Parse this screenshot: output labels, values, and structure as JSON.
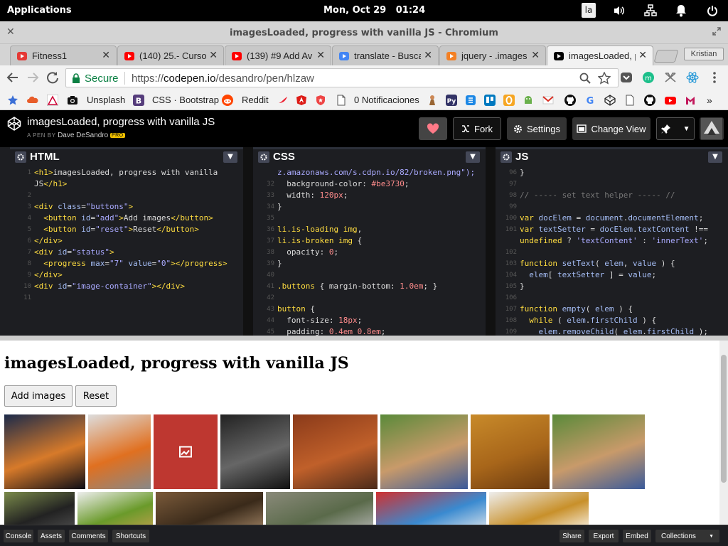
{
  "system_bar": {
    "applications_label": "Applications",
    "clock": "Mon, Oct 29   01:24",
    "keyboard_layout": "la"
  },
  "window": {
    "title": "imagesLoaded, progress with vanilla JS - Chromium"
  },
  "tabs": [
    {
      "label": "Fitness1",
      "icon": "fitness-favicon",
      "color": "#e53935"
    },
    {
      "label": "(140) 25.- Curso",
      "icon": "youtube-favicon",
      "color": "#ff0000"
    },
    {
      "label": "(139) #9 Add Av",
      "icon": "youtube-favicon",
      "color": "#ff0000"
    },
    {
      "label": "translate - Busca",
      "icon": "google-favicon",
      "color": "#4285f4"
    },
    {
      "label": "jquery - .images",
      "icon": "stackoverflow-favicon",
      "color": "#f48024"
    },
    {
      "label": "imagesLoaded, p",
      "icon": "codepen-favicon",
      "color": "#000000",
      "active": true
    }
  ],
  "profile_name": "Kristian",
  "omnibox": {
    "secure_label": "Secure",
    "url_prefix": "https://",
    "url_domain": "codepen.io",
    "url_path": "/desandro/pen/hlzaw"
  },
  "bookmarks": [
    {
      "label": "Unsplash"
    },
    {
      "label": "CSS · Bootstrap"
    },
    {
      "label": "Reddit"
    },
    {
      "label": "0 Notificaciones"
    }
  ],
  "codepen": {
    "pen_title": "imagesLoaded, progress with vanilla JS",
    "by_prefix": "A PEN BY",
    "author": "Dave DeSandro",
    "pro_badge": "PRO",
    "buttons": {
      "fork": "Fork",
      "settings": "Settings",
      "change_view": "Change View"
    },
    "heart_color": "#ff3c41"
  },
  "editors": {
    "html": {
      "title": "HTML",
      "lines": [
        {
          "n": "1",
          "html": "<span class=\"t-tag\">&lt;h1&gt;</span>imagesLoaded, progress with vanilla"
        },
        {
          "n": "",
          "html": "JS<span class=\"t-tag\">&lt;/h1&gt;</span>"
        },
        {
          "n": "2",
          "html": ""
        },
        {
          "n": "3",
          "html": "<span class=\"t-tag\">&lt;div</span> <span class=\"t-attr\">class</span>=<span class=\"t-str\">\"buttons\"</span><span class=\"t-tag\">&gt;</span>"
        },
        {
          "n": "4",
          "html": "  <span class=\"t-tag\">&lt;button</span> <span class=\"t-attr\">id</span>=<span class=\"t-str\">\"add\"</span><span class=\"t-tag\">&gt;</span>Add images<span class=\"t-tag\">&lt;/button&gt;</span>"
        },
        {
          "n": "5",
          "html": "  <span class=\"t-tag\">&lt;button</span> <span class=\"t-attr\">id</span>=<span class=\"t-str\">\"reset\"</span><span class=\"t-tag\">&gt;</span>Reset<span class=\"t-tag\">&lt;/button&gt;</span>"
        },
        {
          "n": "6",
          "html": "<span class=\"t-tag\">&lt;/div&gt;</span>"
        },
        {
          "n": "7",
          "html": "<span class=\"t-tag\">&lt;div</span> <span class=\"t-attr\">id</span>=<span class=\"t-str\">\"status\"</span><span class=\"t-tag\">&gt;</span>"
        },
        {
          "n": "8",
          "html": "  <span class=\"t-tag\">&lt;progress</span> <span class=\"t-attr\">max</span>=<span class=\"t-str\">\"7\"</span> <span class=\"t-attr\">value</span>=<span class=\"t-str\">\"0\"</span><span class=\"t-tag\">&gt;&lt;/progress&gt;</span>"
        },
        {
          "n": "9",
          "html": "<span class=\"t-tag\">&lt;/div&gt;</span>"
        },
        {
          "n": "10",
          "html": "<span class=\"t-tag\">&lt;div</span> <span class=\"t-attr\">id</span>=<span class=\"t-str\">\"image-container\"</span><span class=\"t-tag\">&gt;&lt;/div&gt;</span>"
        },
        {
          "n": "11",
          "html": ""
        }
      ]
    },
    "css": {
      "title": "CSS",
      "lines": [
        {
          "n": "",
          "html": "<span class=\"t-str\">z.amazonaws.com/s.cdpn.io/82/broken.png\");</span>"
        },
        {
          "n": "32",
          "html": "  <span class=\"t-prop\">background-color</span>: <span class=\"t-num\">#be3730</span>;"
        },
        {
          "n": "33",
          "html": "  <span class=\"t-prop\">width</span>: <span class=\"t-num\">120px</span>;"
        },
        {
          "n": "34",
          "html": "}"
        },
        {
          "n": "35",
          "html": ""
        },
        {
          "n": "36",
          "html": "<span class=\"t-sel\">li.is-loading img</span>,"
        },
        {
          "n": "37",
          "html": "<span class=\"t-sel\">li.is-broken img</span> {"
        },
        {
          "n": "38",
          "html": "  <span class=\"t-prop\">opacity</span>: <span class=\"t-num\">0</span>;"
        },
        {
          "n": "39",
          "html": "}"
        },
        {
          "n": "40",
          "html": ""
        },
        {
          "n": "41",
          "html": "<span class=\"t-sel\">.buttons</span> { <span class=\"t-prop\">margin-bottom</span>: <span class=\"t-num\">1.0em</span>; }"
        },
        {
          "n": "42",
          "html": ""
        },
        {
          "n": "43",
          "html": "<span class=\"t-sel\">button</span> {"
        },
        {
          "n": "44",
          "html": "  <span class=\"t-prop\">font-size</span>: <span class=\"t-num\">18px</span>;"
        },
        {
          "n": "45",
          "html": "  <span class=\"t-prop\">padding</span>: <span class=\"t-num\">0.4em 0.8em</span>;"
        }
      ]
    },
    "js": {
      "title": "JS",
      "lines": [
        {
          "n": "96",
          "html": "}"
        },
        {
          "n": "97",
          "html": ""
        },
        {
          "n": "98",
          "html": "<span class=\"t-com\">// ----- set text helper ----- //</span>"
        },
        {
          "n": "99",
          "html": ""
        },
        {
          "n": "100",
          "html": "<span class=\"t-kw\">var</span> <span class=\"t-var\">docElem</span> = <span class=\"t-var\">document</span>.<span class=\"t-var\">documentElement</span>;"
        },
        {
          "n": "101",
          "html": "<span class=\"t-kw\">var</span> <span class=\"t-var\">textSetter</span> = <span class=\"t-var\">docElem</span>.<span class=\"t-var\">textContent</span> !=="
        },
        {
          "n": "",
          "html": "<span class=\"t-kw\">undefined</span> ? <span class=\"t-str\">'textContent'</span> : <span class=\"t-str\">'innerText'</span>;"
        },
        {
          "n": "102",
          "html": ""
        },
        {
          "n": "103",
          "html": "<span class=\"t-kw\">function</span> <span class=\"t-var\">setText</span>( <span class=\"t-var\">elem</span>, <span class=\"t-var\">value</span> ) {"
        },
        {
          "n": "104",
          "html": "  <span class=\"t-var\">elem</span>[ <span class=\"t-var\">textSetter</span> ] = <span class=\"t-var\">value</span>;"
        },
        {
          "n": "105",
          "html": "}"
        },
        {
          "n": "106",
          "html": ""
        },
        {
          "n": "107",
          "html": "<span class=\"t-kw\">function</span> <span class=\"t-var\">empty</span>( <span class=\"t-var\">elem</span> ) {"
        },
        {
          "n": "108",
          "html": "  <span class=\"t-kw\">while</span> ( <span class=\"t-var\">elem</span>.<span class=\"t-var\">firstChild</span> ) {"
        },
        {
          "n": "109",
          "html": "    <span class=\"t-var\">elem</span>.<span class=\"t-var\">removeChild</span>( <span class=\"t-var\">elem</span>.<span class=\"t-var\">firstChild</span> );"
        }
      ]
    }
  },
  "preview": {
    "heading": "imagesLoaded, progress with vanilla JS",
    "add_button": "Add images",
    "reset_button": "Reset",
    "images_row1": [
      {
        "name": "city-skyline-image",
        "colors": [
          "#1b2a4a",
          "#d77a2a",
          "#0d0d16"
        ]
      },
      {
        "name": "orange-ipod-image",
        "colors": [
          "#ddd",
          "#e07020",
          "#888"
        ]
      },
      {
        "name": "broken-image",
        "colors": [
          "#be3730",
          "#be3730",
          "#be3730"
        ]
      },
      {
        "name": "electronics-knobs-image",
        "colors": [
          "#222",
          "#666",
          "#111"
        ]
      },
      {
        "name": "autumn-trees-image",
        "colors": [
          "#8a3a1a",
          "#c0602a",
          "#4a2a1a"
        ]
      },
      {
        "name": "baseball-players-image",
        "colors": [
          "#5a8a3a",
          "#c89a6a",
          "#3a5a9a"
        ]
      },
      {
        "name": "potatoes-image",
        "colors": [
          "#c88a2a",
          "#a8661a",
          "#6a3a10"
        ]
      },
      {
        "name": "baseball-catcher-image",
        "colors": [
          "#5a8a3a",
          "#c89a6a",
          "#3a5a9a"
        ]
      }
    ],
    "images_row2": [
      {
        "name": "dark-fabric-image",
        "colors": [
          "#7a8a4a",
          "#222",
          "#555"
        ]
      },
      {
        "name": "food-plate-image",
        "colors": [
          "#eee",
          "#6a9a2a",
          "#c8a050"
        ]
      },
      {
        "name": "old-man-portrait-image",
        "colors": [
          "#7a5a3a",
          "#3a2a1a",
          "#a88a6a"
        ]
      },
      {
        "name": "stone-wall-image",
        "colors": [
          "#8a8a7a",
          "#5a6a4a",
          "#bbb"
        ]
      },
      {
        "name": "abstract-paint-image",
        "colors": [
          "#d03030",
          "#3a8ad0",
          "#eee"
        ]
      },
      {
        "name": "sandwich-image",
        "colors": [
          "#eee",
          "#c8902a",
          "#fff"
        ]
      }
    ]
  },
  "footer": {
    "left": [
      "Console",
      "Assets",
      "Comments",
      "Shortcuts"
    ],
    "right": [
      "Share",
      "Export",
      "Embed",
      "Collections"
    ]
  }
}
